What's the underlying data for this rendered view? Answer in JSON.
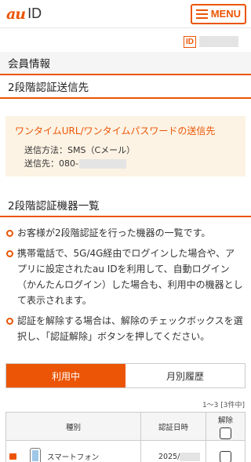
{
  "header": {
    "logo_au": "au",
    "logo_id": "ID",
    "menu_label": "MENU"
  },
  "account": {
    "id_badge": "ID"
  },
  "sections": {
    "member_info": "会員情報",
    "two_step_destination": "2段階認証送信先",
    "two_step_devices": "2段階認証機器一覧"
  },
  "notice": {
    "title": "ワンタイムURL/ワンタイムパスワードの送信先",
    "method": "送信方法：SMS（Cメール）",
    "destination_prefix": "送信先：080-"
  },
  "bullets": [
    "お客様が2段階認証を行った機器の一覧です。",
    "携帯電話で、5G/4G経由でログインした場合や、アプリに設定されたau IDを利用して、自動ログイン（かんたんログイン）した場合も、利用中の機器として表示されます。",
    "認証を解除する場合は、解除のチェックボックスを選択し、「認証解除」ボタンを押してください。"
  ],
  "tabs": [
    {
      "label": "利用中",
      "active": true
    },
    {
      "label": "月別履歴",
      "active": false
    }
  ],
  "count_text": "1～3 [3件中]",
  "table": {
    "headers": {
      "type": "種別",
      "date": "認証日時",
      "release": "解除"
    },
    "rows": [
      {
        "device": "スマートフォン",
        "date_prefix": "2025/"
      }
    ]
  },
  "colors": {
    "accent": "#eb5505",
    "notice_bg": "#fdf3e4"
  }
}
